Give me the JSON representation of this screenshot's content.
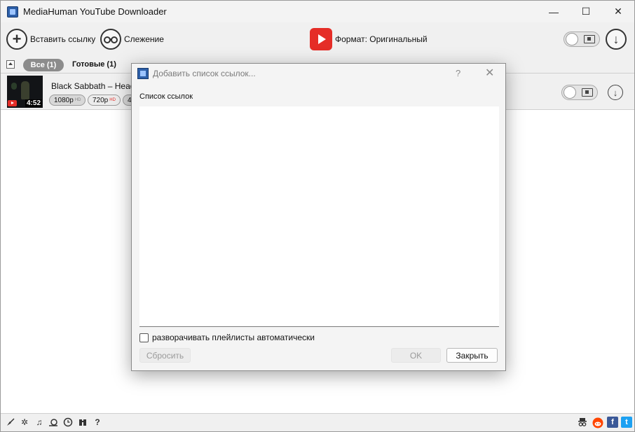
{
  "window": {
    "title": "MediaHuman YouTube Downloader",
    "controls": {
      "minimize": "—",
      "maximize": "☐",
      "close": "✕"
    }
  },
  "toolbar": {
    "paste_link_label": "Вставить ссылку",
    "tracking_label": "Слежение",
    "format_label": "Формат: Оригинальный"
  },
  "filters": {
    "all_label": "Все (1)",
    "done_label": "Готовые (1)"
  },
  "download_item": {
    "title": "Black Sabbath – Headles",
    "duration": "4:52",
    "qualities": [
      {
        "label": "1080p",
        "tag": "HD"
      },
      {
        "label": "720p",
        "tag": "HD"
      },
      {
        "label": "4",
        "tag": ""
      }
    ]
  },
  "statusbar": {
    "icons": [
      "broom-icon",
      "gear-icon",
      "music-icon",
      "snail-icon",
      "clock-icon",
      "binoculars-icon",
      "help-icon"
    ],
    "help_glyph": "?",
    "social": {
      "facebook": "f",
      "twitter": "t"
    }
  },
  "dialog": {
    "title": "Добавить список ссылок...",
    "help": "?",
    "close": "✕",
    "list_label": "Список ссылок",
    "textarea_value": "",
    "checkbox_label": "разворачивать плейлисты автоматически",
    "checkbox_checked": false,
    "reset_label": "Сбросить",
    "ok_label": "OK",
    "close_label": "Закрыть"
  },
  "colors": {
    "youtube_red": "#e52d27",
    "facebook_blue": "#3b5998",
    "twitter_blue": "#1da1f2",
    "reddit_orange": "#ff4500"
  }
}
